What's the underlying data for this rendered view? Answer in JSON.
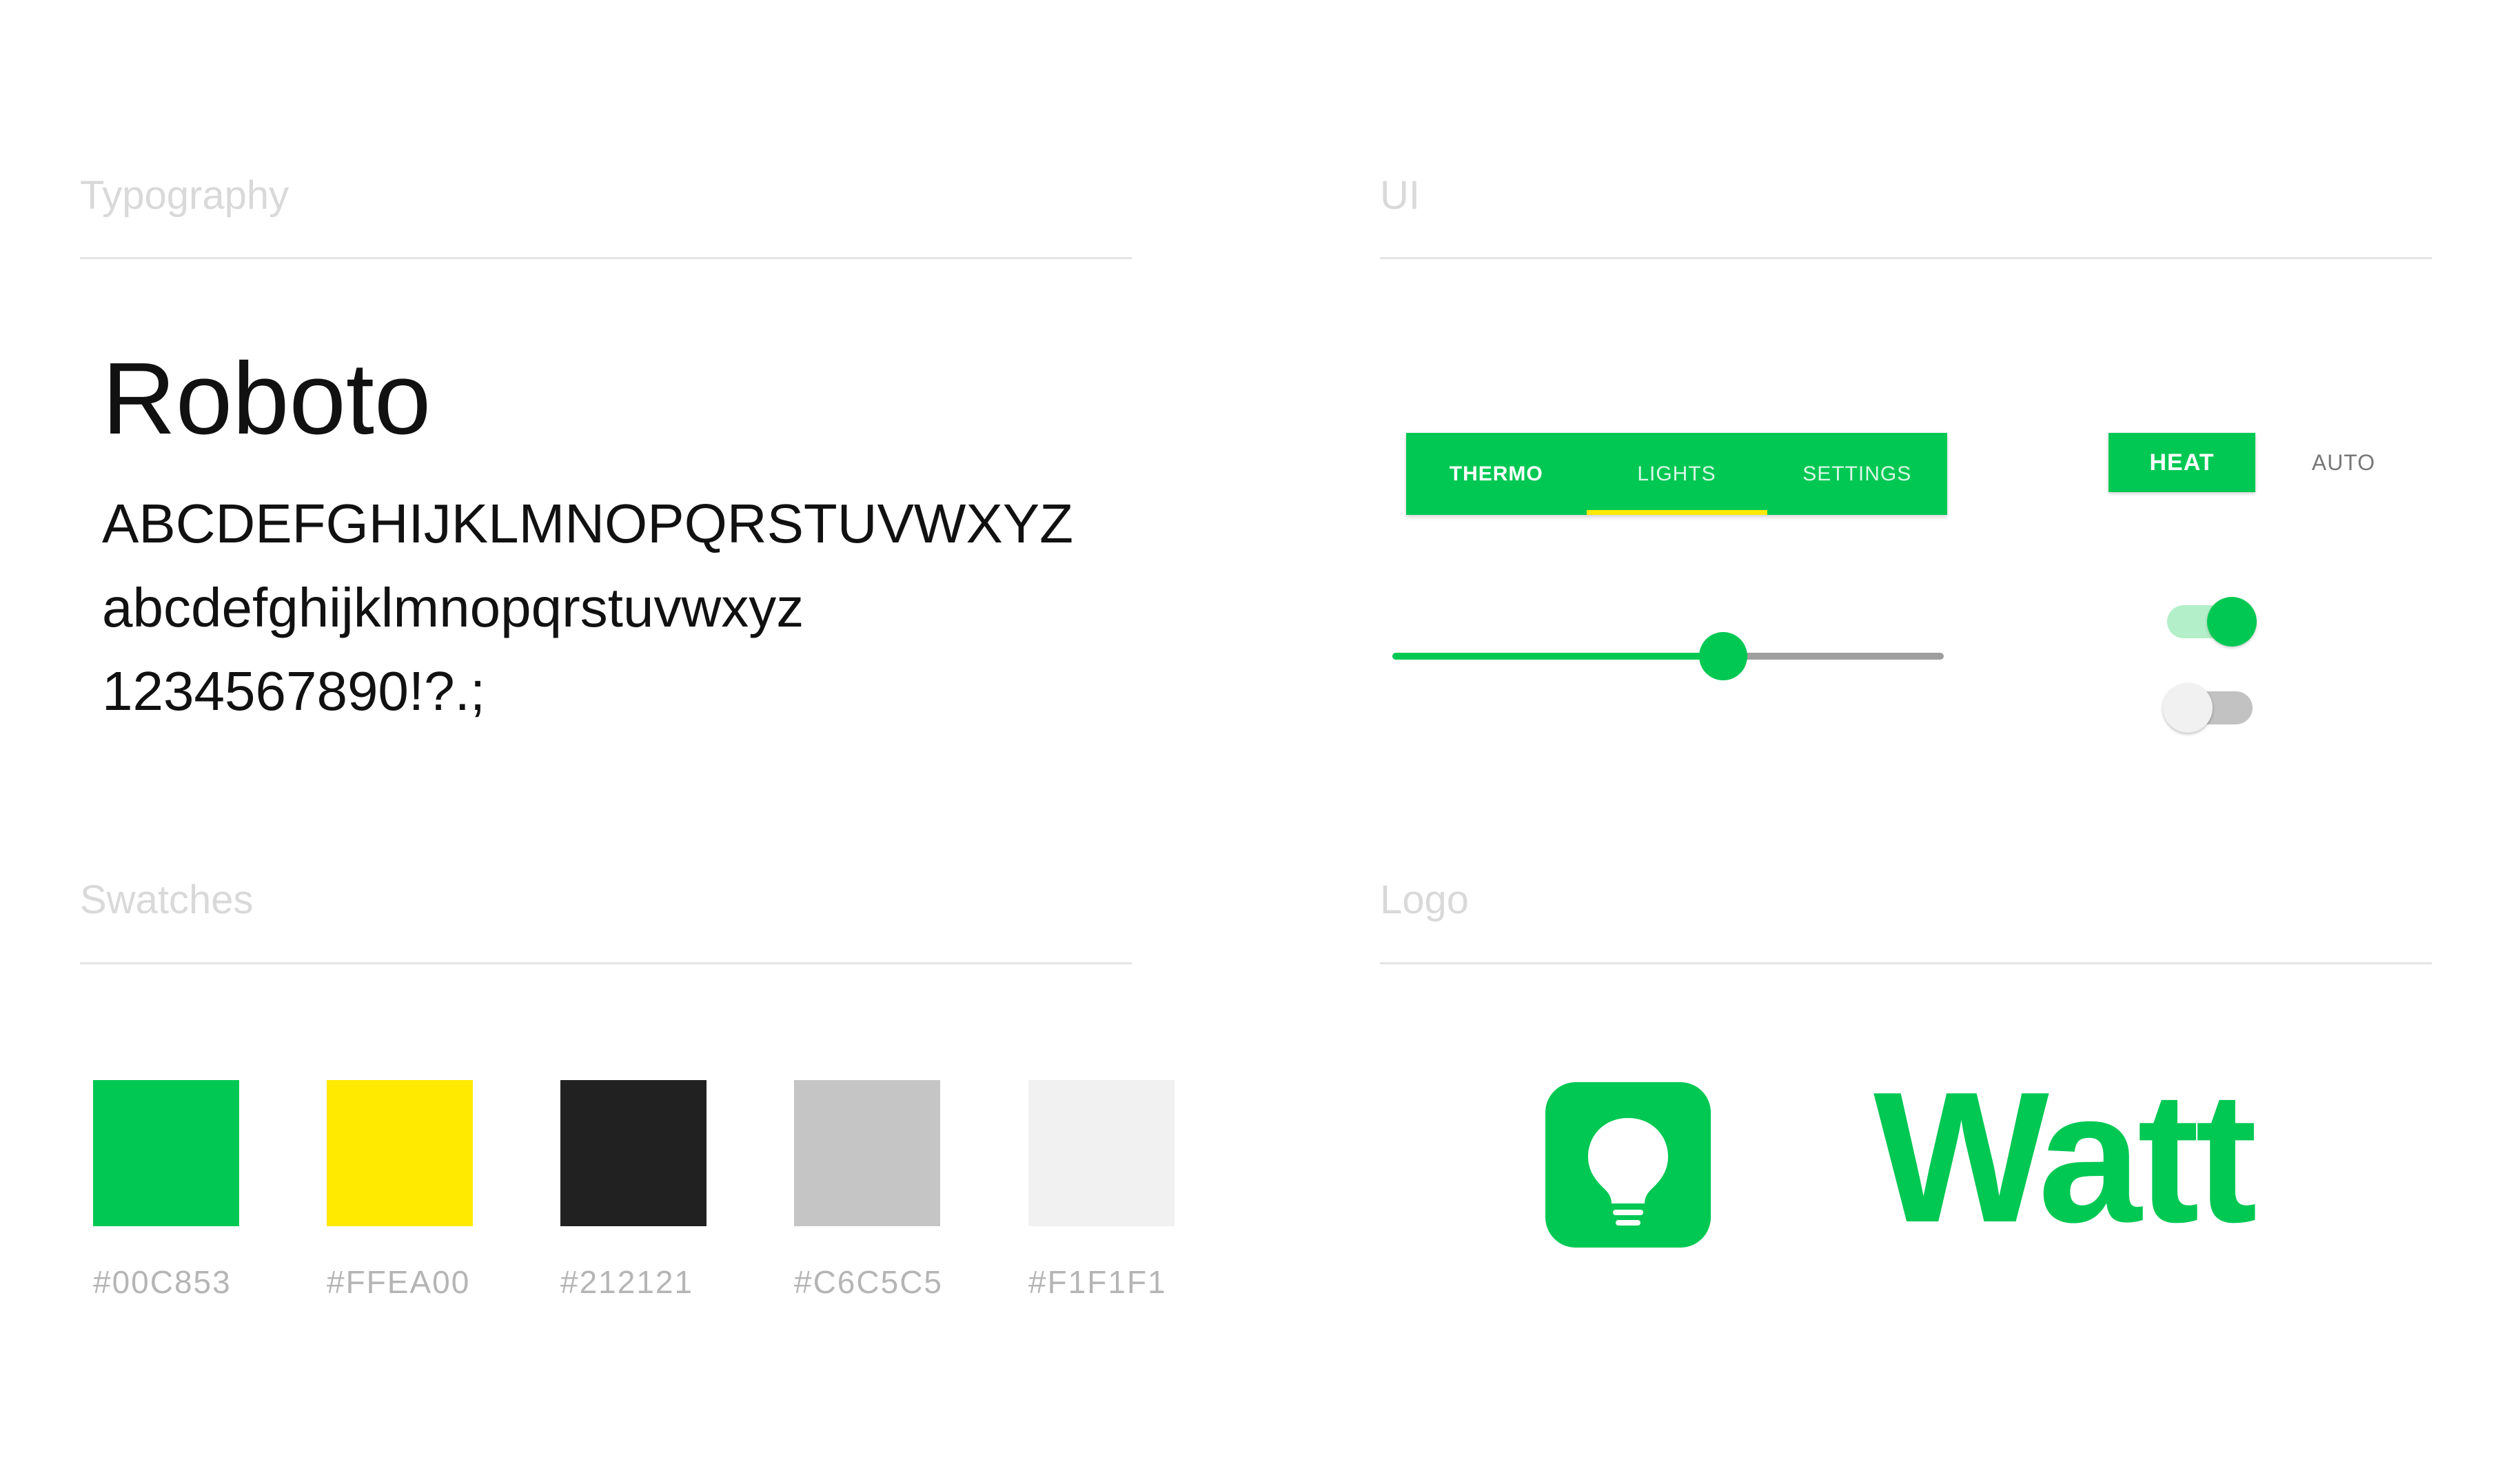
{
  "sections": {
    "typography": "Typography",
    "ui": "UI",
    "swatches": "Swatches",
    "logo": "Logo"
  },
  "typography": {
    "font_name": "Roboto",
    "uppercase": "ABCDEFGHIJKLMNOPQRSTUVWXYZ",
    "lowercase": "abcdefghijklmnopqrstuvwxyz",
    "numerals": "1234567890!?.;"
  },
  "tabs": [
    {
      "label": "THERMO"
    },
    {
      "label": "LIGHTS"
    },
    {
      "label": "SETTINGS"
    }
  ],
  "mode_buttons": {
    "heat": "HEAT",
    "auto": "AUTO"
  },
  "slider": {
    "value_fraction": 0.6
  },
  "switches": [
    {
      "state": "on"
    },
    {
      "state": "off"
    }
  ],
  "swatches": [
    {
      "color": "#00C853",
      "label": "#00C853"
    },
    {
      "color": "#FFEA00",
      "label": "#FFEA00"
    },
    {
      "color": "#212121",
      "label": "#212121"
    },
    {
      "color": "#C6C5C5",
      "label": "#C6C5C5"
    },
    {
      "color": "#F1F1F1",
      "label": "#F1F1F1"
    }
  ],
  "logo": {
    "wordmark": "Watt",
    "icon": "lightbulb-icon",
    "brand_color": "#00C853"
  }
}
